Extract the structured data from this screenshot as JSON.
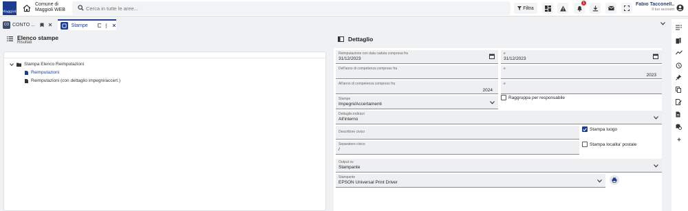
{
  "header": {
    "logo_text": "Maggioli",
    "comune": "Comune di",
    "app": "Maggioli WEB",
    "search_placeholder": "Cerca in tutte le aree...",
    "filtra": "Filtra",
    "notif_count": "1",
    "user_name": "Fabio Tacconell...",
    "user_sub": "Il tuo account"
  },
  "tabs": [
    {
      "label": "CONTO ...",
      "icon_text": "CO"
    },
    {
      "label": "Stampe"
    }
  ],
  "left": {
    "title": "Elenco stampe",
    "subtitle": "Risultati",
    "tree": [
      {
        "label": "Stampa Elenco Reimputazioni",
        "level": 0
      },
      {
        "label": "Reimputazioni",
        "level": 1,
        "selected": true
      },
      {
        "label": "Reimputazioni (con dettaglio impegni/accert.)",
        "level": 1
      }
    ]
  },
  "right": {
    "title": "Dettaglio",
    "fields": {
      "reimp_from_label": "Reimputazione con data caduta compresa fra",
      "reimp_from": "31/12/2023",
      "reimp_to_label": "e",
      "reimp_to": "31/12/2023",
      "anno_from_label": "Dell'anno di competenza compreso fra",
      "anno_from": "",
      "anno_to_label": "e",
      "anno_to": "2023",
      "anno_comp_from_label": "All'anno di competenza compreso fra",
      "anno_comp_from": "2024",
      "anno_comp_to_label": "e",
      "anno_comp_to": "",
      "stampe_label": "Stampe",
      "stampe": "Impegni/Accertamenti",
      "raggruppa": "Raggruppa per responsabile",
      "dettaglio_label": "Dettaglio indirizzi",
      "dettaglio": "All'interno",
      "descrittore_label": "Descrittore civico",
      "descrittore": "",
      "stampa_luogo": "Stampa luogo",
      "separatore_label": "Separatore civico",
      "separatore": "/",
      "stampa_localita": "Stampa localita' postale",
      "output_label": "Output su",
      "output": "Stampante",
      "stampante_label": "Stampante",
      "stampante": "EPSON Universal Print Driver"
    }
  },
  "colors": {
    "brand": "#1f3d8f",
    "badge": "#d9262c"
  }
}
